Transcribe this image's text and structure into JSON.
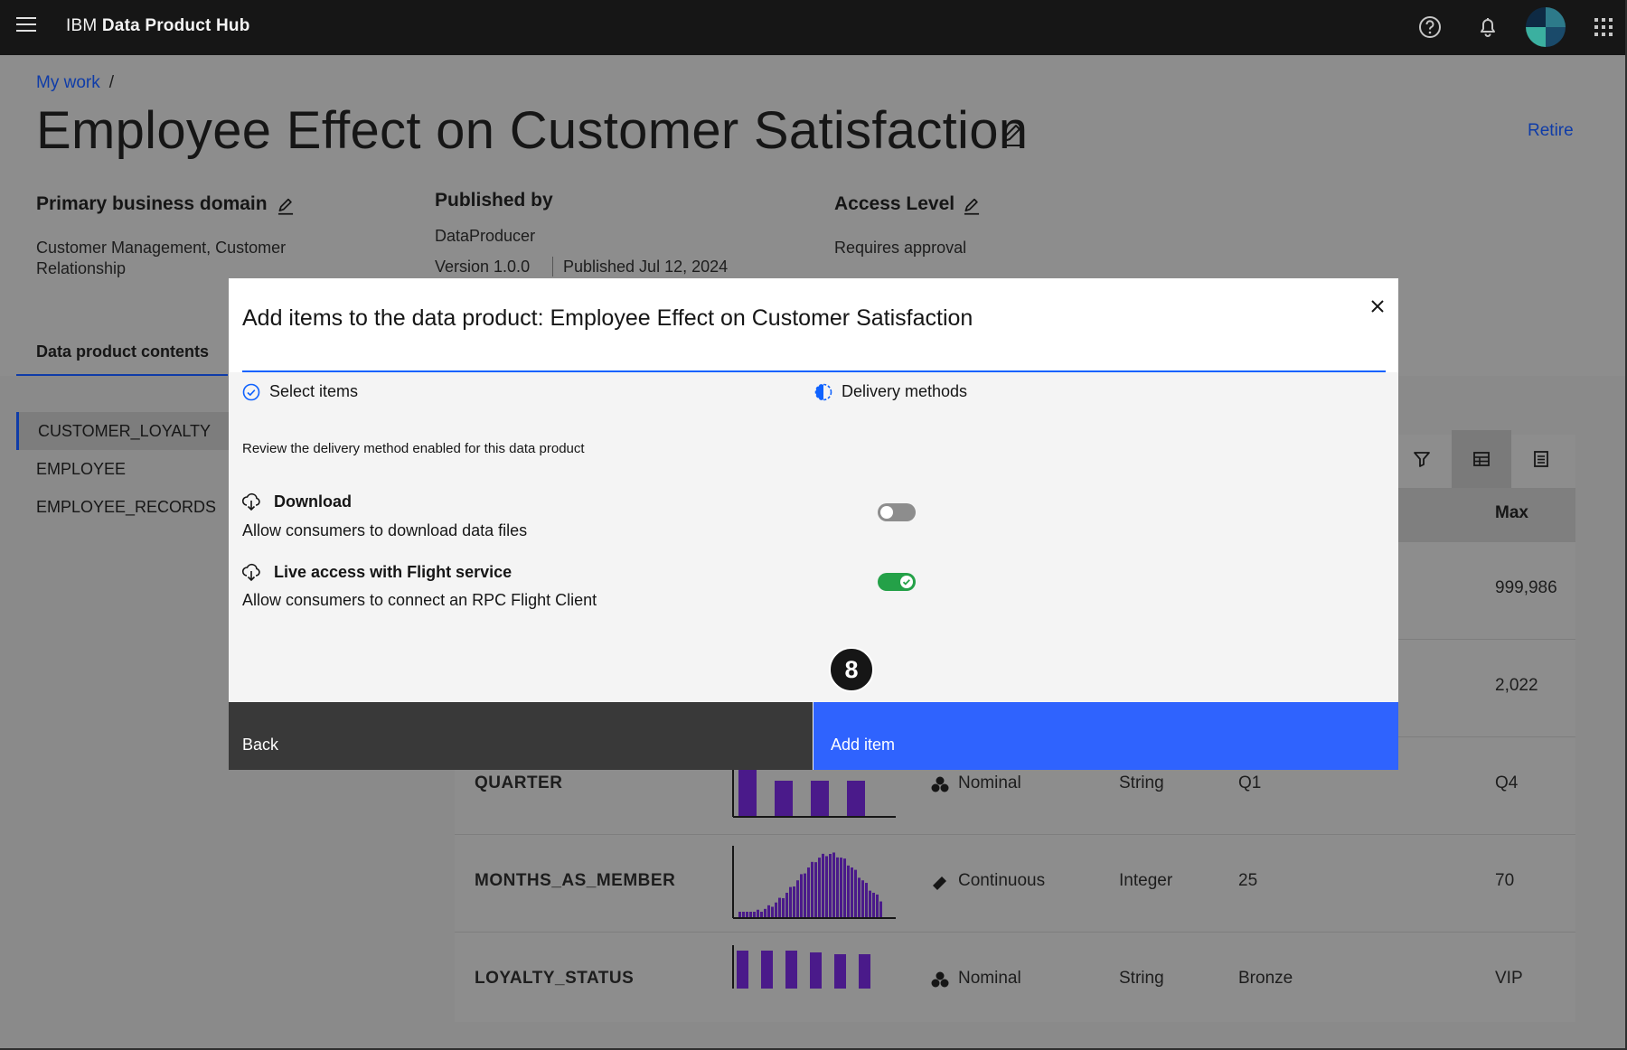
{
  "topbar": {
    "brand_prefix": "IBM",
    "brand_name": "Data Product Hub",
    "icons": [
      "menu-icon",
      "help-icon",
      "notification-icon",
      "user-avatar",
      "app-switcher-icon"
    ]
  },
  "breadcrumb": {
    "link": "My work",
    "separator": "/"
  },
  "page": {
    "title": "Employee Effect on Customer Satisfaction",
    "retire_label": "Retire",
    "primary_domain": {
      "label": "Primary business domain",
      "value_line1": "Customer Management, Customer",
      "value_line2": "Relationship"
    },
    "published_by": {
      "label": "Published by",
      "value": "DataProducer",
      "version": "Version 1.0.0",
      "published": "Published Jul 12, 2024"
    },
    "access_level": {
      "label": "Access Level",
      "value": "Requires approval"
    },
    "tab_label": "Data product contents",
    "tables": [
      "CUSTOMER_LOYALTY",
      "EMPLOYEE",
      "EMPLOYEE_RECORDS"
    ]
  },
  "grid": {
    "max_header": "Max",
    "rows": [
      {
        "name": "",
        "measure": "",
        "type": "",
        "min": "",
        "max": "999,986"
      },
      {
        "name": "",
        "measure": "",
        "type": "",
        "min": "",
        "max": "2,022"
      },
      {
        "name": "QUARTER",
        "measure": "Nominal",
        "type": "String",
        "min": "Q1",
        "max": "Q4"
      },
      {
        "name": "MONTHS_AS_MEMBER",
        "measure": "Continuous",
        "type": "Integer",
        "min": "25",
        "max": "70"
      },
      {
        "name": "LOYALTY_STATUS",
        "measure": "Nominal",
        "type": "String",
        "min": "Bronze",
        "max": "VIP"
      }
    ]
  },
  "modal": {
    "title": "Add items to the data product: Employee Effect on Customer Satisfaction",
    "steps": [
      {
        "label": "Select items",
        "state": "complete"
      },
      {
        "label": "Delivery methods",
        "state": "current"
      }
    ],
    "review_text": "Review the delivery method enabled for this data product",
    "methods": [
      {
        "title": "Download",
        "description": "Allow consumers to download data files",
        "enabled": false
      },
      {
        "title": "Live access with Flight service",
        "description": "Allow consumers to connect an RPC Flight Client",
        "enabled": true
      }
    ],
    "back_label": "Back",
    "add_label": "Add item"
  },
  "annotation": {
    "step_number": "8"
  },
  "colors": {
    "topbar": "#161616",
    "link": "#0f3ca8",
    "primary_button": "#2f63fe",
    "secondary_button": "#393939",
    "toggle_on": "#24a148",
    "histogram": "#4a1a8a"
  }
}
